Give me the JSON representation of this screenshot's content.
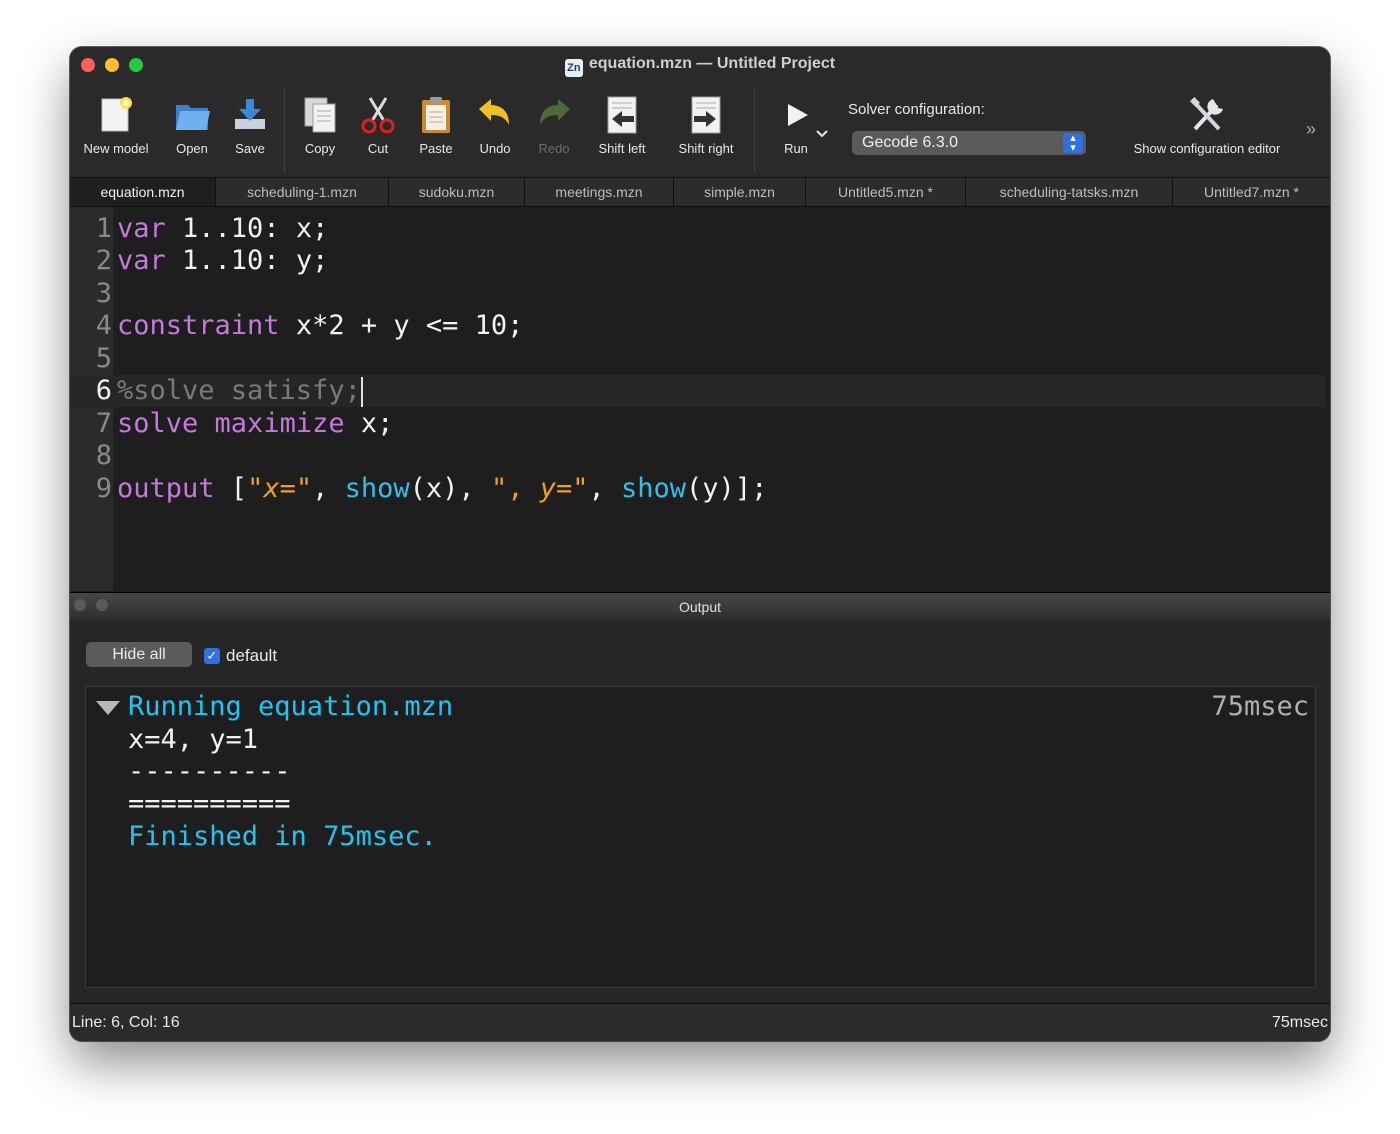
{
  "window": {
    "title": "equation.mzn — Untitled Project",
    "app_icon": "Zn"
  },
  "toolbar": {
    "new_model": "New model",
    "open": "Open",
    "save": "Save",
    "copy": "Copy",
    "cut": "Cut",
    "paste": "Paste",
    "undo": "Undo",
    "redo": "Redo",
    "shift_left": "Shift left",
    "shift_right": "Shift right",
    "run": "Run",
    "solver_label": "Solver configuration:",
    "solver_value": "Gecode 6.3.0",
    "show_config": "Show configuration editor",
    "overflow": "»"
  },
  "tabs": [
    {
      "label": "equation.mzn",
      "active": true
    },
    {
      "label": "scheduling-1.mzn",
      "active": false
    },
    {
      "label": "sudoku.mzn",
      "active": false
    },
    {
      "label": "meetings.mzn",
      "active": false
    },
    {
      "label": "simple.mzn",
      "active": false
    },
    {
      "label": "Untitled5.mzn *",
      "active": false
    },
    {
      "label": "scheduling-tatsks.mzn",
      "active": false
    },
    {
      "label": "Untitled7.mzn *",
      "active": false
    }
  ],
  "editor": {
    "line_numbers": [
      "1",
      "2",
      "3",
      "4",
      "5",
      "6",
      "7",
      "8",
      "9"
    ],
    "current_line": 6,
    "code": {
      "l1": {
        "kw": "var",
        "rest": " 1..10: x;"
      },
      "l2": {
        "kw": "var",
        "rest": " 1..10: y;"
      },
      "l4": {
        "kw": "constraint",
        "rest": " x*2 + y <= 10;"
      },
      "l6": {
        "comment": "%solve satisfy;"
      },
      "l7": {
        "kw1": "solve",
        "sp": " ",
        "kw2": "maximize",
        "rest": " x;"
      },
      "l9": {
        "kw": "output",
        "open": " [",
        "q1": "\"",
        "s1": "x=",
        "q2": "\"",
        "c1": ", ",
        "f1": "show",
        "a1": "(x), ",
        "q3": "\",",
        "sp": " ",
        "s2": "y=",
        "q4": "\"",
        "c2": ", ",
        "f2": "show",
        "a2": "(y)];"
      }
    }
  },
  "output_panel": {
    "title": "Output",
    "hide_all": "Hide all",
    "checkbox_label": "default",
    "checkbox_checked": true,
    "running": "Running equation.mzn",
    "time": "75msec",
    "result": "x=4, y=1",
    "sep1": "----------",
    "sep2": "==========",
    "finished": "Finished in 75msec."
  },
  "status_bar": {
    "position": "Line: 6, Col: 16",
    "time": "75msec"
  },
  "colors": {
    "keyword": "#c678dd",
    "function": "#36bde8",
    "string": "#f0a020",
    "comment": "#7a7a7a",
    "output_accent": "#22c4f0"
  }
}
